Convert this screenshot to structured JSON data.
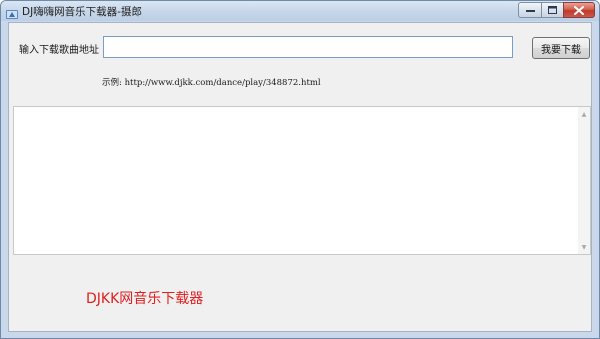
{
  "window": {
    "title": "DJ嗨嗨网音乐下载器-摄郎"
  },
  "form": {
    "url_label": "输入下载歌曲地址",
    "url_value": "",
    "download_button": "我要下载",
    "example": "示例: http://www.djkk.com/dance/play/348872.html"
  },
  "log": {
    "content": ""
  },
  "footer": {
    "brand": "DJKK网音乐下载器",
    "brand_color": "#e02020"
  },
  "icons": {
    "app": "app-icon",
    "minimize": "minimize-icon",
    "maximize": "maximize-icon",
    "close": "close-icon",
    "scroll_up": "scroll-up-arrow-icon",
    "scroll_down": "scroll-down-arrow-icon"
  }
}
